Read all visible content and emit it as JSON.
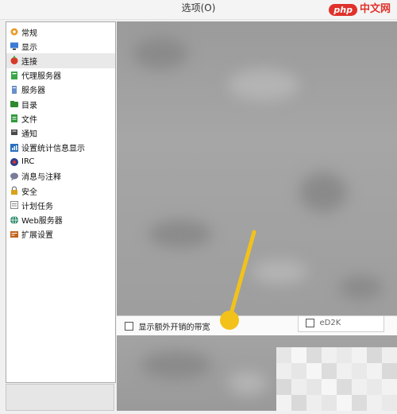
{
  "window": {
    "title": "选项(O)"
  },
  "brand": {
    "php": "php",
    "cn": "中文网"
  },
  "sidebar": {
    "items": [
      {
        "label": "常规",
        "icon": "general-settings-icon",
        "color": "#e89a2a",
        "selected": false
      },
      {
        "label": "显示",
        "icon": "display-icon",
        "color": "#3a7bd5",
        "selected": false
      },
      {
        "label": "连接",
        "icon": "connection-icon",
        "color": "#d63a2a",
        "selected": true
      },
      {
        "label": "代理服务器",
        "icon": "proxy-server-icon",
        "color": "#3aa64a",
        "selected": false
      },
      {
        "label": "服务器",
        "icon": "server-icon",
        "color": "#6a8fc8",
        "selected": false
      },
      {
        "label": "目录",
        "icon": "directory-icon",
        "color": "#2f8a2f",
        "selected": false
      },
      {
        "label": "文件",
        "icon": "file-icon",
        "color": "#2f9a3a",
        "selected": false
      },
      {
        "label": "通知",
        "icon": "notification-icon",
        "color": "#4a4a4a",
        "selected": false
      },
      {
        "label": "设置统计信息显示",
        "icon": "statistics-icon",
        "color": "#2a6fc0",
        "selected": false
      },
      {
        "label": "IRC",
        "icon": "irc-icon",
        "color": "#2a3f8a",
        "selected": false
      },
      {
        "label": "消息与注释",
        "icon": "messages-icon",
        "color": "#7a7a9a",
        "selected": false
      },
      {
        "label": "安全",
        "icon": "lock-icon",
        "color": "#d9a21a",
        "selected": false
      },
      {
        "label": "计划任务",
        "icon": "schedule-icon",
        "color": "#8a8a8a",
        "selected": false
      },
      {
        "label": "Web服务器",
        "icon": "web-server-icon",
        "color": "#2a8a6a",
        "selected": false
      },
      {
        "label": "扩展设置",
        "icon": "extended-settings-icon",
        "color": "#c0621a",
        "selected": false
      }
    ]
  },
  "options": {
    "show_extra_bandwidth": {
      "label": "显示额外开销的带宽",
      "checked": false
    },
    "ed2k": {
      "label": "eD2K",
      "checked": false
    }
  },
  "annotation": {
    "color": "#f2c21b"
  }
}
